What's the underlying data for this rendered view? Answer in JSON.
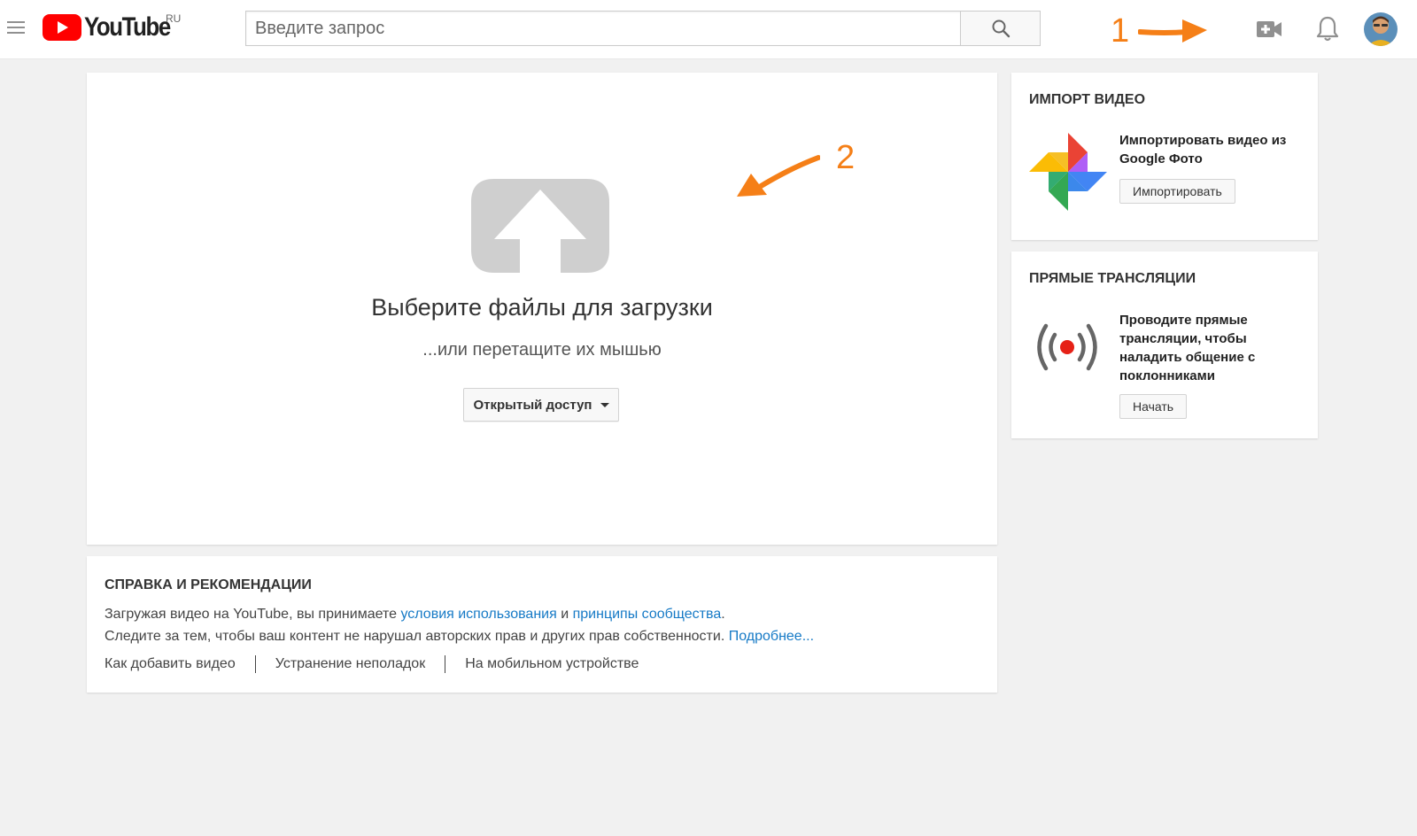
{
  "header": {
    "logo_text": "YouTube",
    "logo_region": "RU",
    "search_placeholder": "Введите запрос"
  },
  "annotations": {
    "label_1": "1",
    "label_2": "2",
    "color": "#f57f17"
  },
  "upload": {
    "title": "Выберите файлы для загрузки",
    "subtitle": "...или перетащите их мышью",
    "privacy_label": "Открытый доступ"
  },
  "help": {
    "title": "СПРАВКА И РЕКОМЕНДАЦИИ",
    "line1_text": "Загружая видео на YouTube, вы принимаете",
    "terms_link": "условия использования",
    "line1_and": "и",
    "guidelines_link": "принципы сообщества",
    "line1_end": ".",
    "line2_text": "Следите за тем, чтобы ваш контент не нарушал авторских прав и других прав собственности.",
    "more_link": "Подробнее...",
    "links": [
      "Как добавить видео",
      "Устранение неполадок",
      "На мобильном устройстве"
    ]
  },
  "import": {
    "title": "ИМПОРТ ВИДЕО",
    "description": "Импортировать видео из Google Фото",
    "button": "Импортировать"
  },
  "live": {
    "title": "ПРЯМЫЕ ТРАНСЛЯЦИИ",
    "description": "Проводите прямые трансляции, чтобы наладить общение с поклонниками",
    "button": "Начать"
  },
  "colors": {
    "brand_red": "#ff0000",
    "link_blue": "#167ac6",
    "background": "#f1f1f1"
  },
  "icons": [
    "menu-icon",
    "youtube-logo-icon",
    "search-icon",
    "upload-video-icon",
    "bell-icon",
    "avatar",
    "upload-arrow-icon",
    "google-photos-icon",
    "live-broadcast-icon",
    "dropdown-caret-icon"
  ]
}
